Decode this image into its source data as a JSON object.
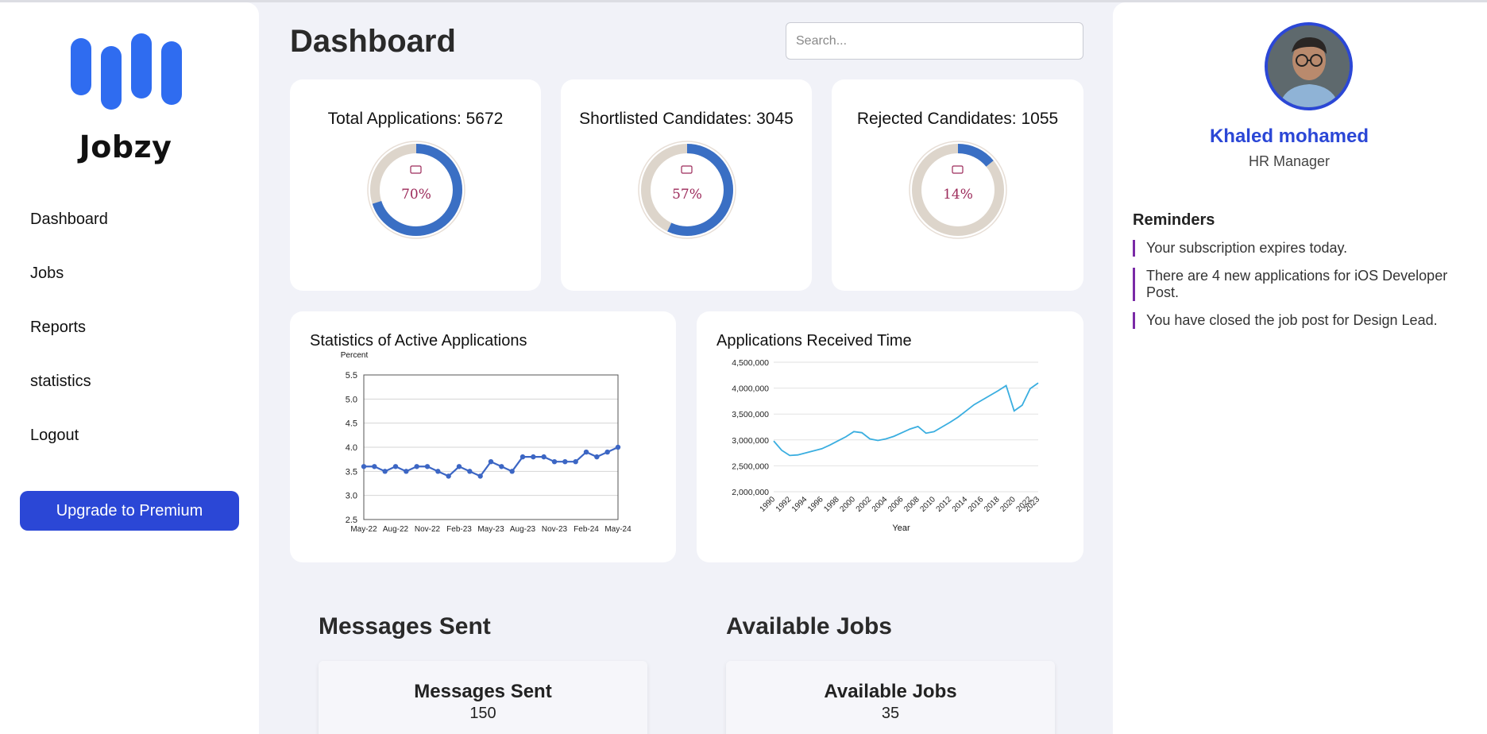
{
  "app": {
    "brand": "Jobzy"
  },
  "sidebar": {
    "items": [
      {
        "label": "Dashboard"
      },
      {
        "label": "Jobs"
      },
      {
        "label": "Reports"
      },
      {
        "label": "statistics"
      },
      {
        "label": "Logout"
      }
    ],
    "upgrade_label": "Upgrade to Premium"
  },
  "header": {
    "title": "Dashboard",
    "search_placeholder": "Search..."
  },
  "stats": [
    {
      "label": "Total Applications: 5672",
      "percent_label": "70%",
      "percent": 70
    },
    {
      "label": "Shortlisted Candidates: 3045",
      "percent_label": "57%",
      "percent": 57
    },
    {
      "label": "Rejected Candidates: 1055",
      "percent_label": "14%",
      "percent": 14
    }
  ],
  "colors": {
    "accent": "#2b47d6",
    "donut_fill": "#3a6fc4",
    "donut_track": "#ddd5cb",
    "donut_text": "#9c2a5a",
    "line_blue": "#3c66c4",
    "line_cyan": "#3aaee0",
    "reminder_bar": "#7a2aa6"
  },
  "chart_data": [
    {
      "type": "line",
      "title": "Statistics of Active Applications",
      "ylabel": "Percent",
      "ylim": [
        2.5,
        5.5
      ],
      "yticks": [
        "2.5",
        "3.0",
        "3.5",
        "4.0",
        "4.5",
        "5.0",
        "5.5"
      ],
      "xticks": [
        "May-22",
        "Aug-22",
        "Nov-22",
        "Feb-23",
        "May-23",
        "Aug-23",
        "Nov-23",
        "Feb-24",
        "May-24"
      ],
      "grid": true,
      "values": [
        3.6,
        3.6,
        3.5,
        3.6,
        3.5,
        3.6,
        3.6,
        3.5,
        3.4,
        3.6,
        3.5,
        3.4,
        3.7,
        3.6,
        3.5,
        3.8,
        3.8,
        3.8,
        3.7,
        3.7,
        3.7,
        3.9,
        3.8,
        3.9,
        4.0
      ]
    },
    {
      "type": "line",
      "title": "Applications Received Time",
      "xlabel": "Year",
      "ylim": [
        2000000,
        4500000
      ],
      "yticks": [
        "2,000,000",
        "2,500,000",
        "3,000,000",
        "3,500,000",
        "4,000,000",
        "4,500,000"
      ],
      "xticks": [
        "1990",
        "1992",
        "1994",
        "1996",
        "1998",
        "2000",
        "2002",
        "2004",
        "2006",
        "2008",
        "2010",
        "2012",
        "2014",
        "2016",
        "2018",
        "2020",
        "2022",
        "2023"
      ],
      "grid": true,
      "x": [
        1990,
        1991,
        1992,
        1993,
        1994,
        1995,
        1996,
        1997,
        1998,
        1999,
        2000,
        2001,
        2002,
        2003,
        2004,
        2005,
        2006,
        2007,
        2008,
        2009,
        2010,
        2011,
        2012,
        2013,
        2014,
        2015,
        2016,
        2017,
        2018,
        2019,
        2020,
        2021,
        2022,
        2023
      ],
      "values": [
        2980000,
        2800000,
        2700000,
        2710000,
        2750000,
        2790000,
        2830000,
        2900000,
        2980000,
        3060000,
        3160000,
        3140000,
        3020000,
        2990000,
        3020000,
        3070000,
        3140000,
        3210000,
        3260000,
        3130000,
        3160000,
        3250000,
        3340000,
        3440000,
        3560000,
        3680000,
        3770000,
        3860000,
        3950000,
        4050000,
        3560000,
        3670000,
        3990000,
        4100000
      ]
    }
  ],
  "messages": {
    "section_title": "Messages Sent",
    "card_title": "Messages Sent",
    "value": "150"
  },
  "jobs": {
    "section_title": "Available Jobs",
    "card_title": "Available Jobs",
    "value": "35"
  },
  "profile": {
    "name": "Khaled mohamed",
    "role": "HR Manager"
  },
  "reminders": {
    "title": "Reminders",
    "items": [
      "Your subscription expires today.",
      "There are 4 new applications for iOS Developer Post.",
      "You have closed the job post for Design Lead."
    ]
  }
}
